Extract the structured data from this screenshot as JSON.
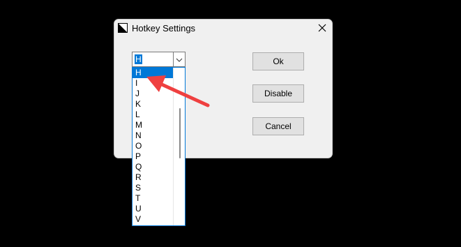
{
  "dialog": {
    "title": "Hotkey Settings",
    "icon": "app-icon",
    "close_icon": "close-icon"
  },
  "hotkey_combo": {
    "selected": "H",
    "options": [
      "H",
      "I",
      "J",
      "K",
      "L",
      "M",
      "N",
      "O",
      "P",
      "Q",
      "R",
      "S",
      "T",
      "U",
      "V"
    ],
    "highlighted_index": 0
  },
  "buttons": {
    "ok": "Ok",
    "disable": "Disable",
    "cancel": "Cancel"
  },
  "colors": {
    "accent": "#0078d7",
    "annotation_arrow": "#ef4040",
    "background": "#000000",
    "dialog": "#f0f0f0"
  }
}
